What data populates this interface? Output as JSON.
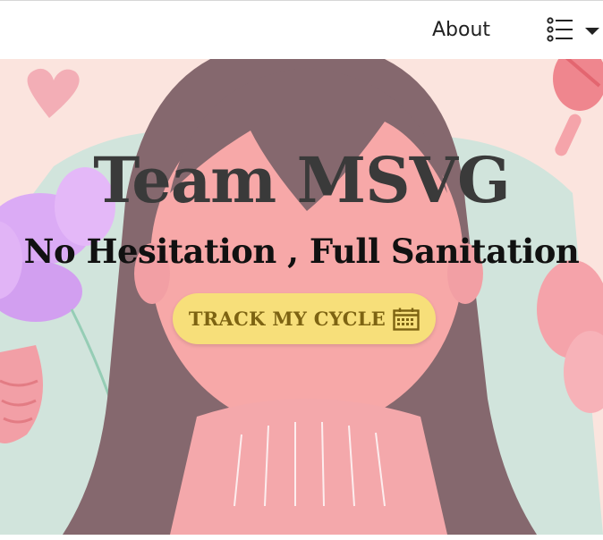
{
  "nav": {
    "about_label": "About",
    "menu_icon": "list-bulleted-icon",
    "dropdown_icon": "caret-down-icon"
  },
  "hero": {
    "title": "Team MSVG",
    "subtitle": "No Hesitation , Full Sanitation",
    "cta_label": "TRACK MY CYCLE",
    "cta_icon": "calendar-icon",
    "illustration": "girl-portrait-illustration"
  },
  "colors": {
    "hero_background": "#fbe3dc",
    "hair": "#7e5f65",
    "skin": "#f7a3a3",
    "cta_background": "#f7df7a",
    "cta_text": "#7d6312"
  }
}
